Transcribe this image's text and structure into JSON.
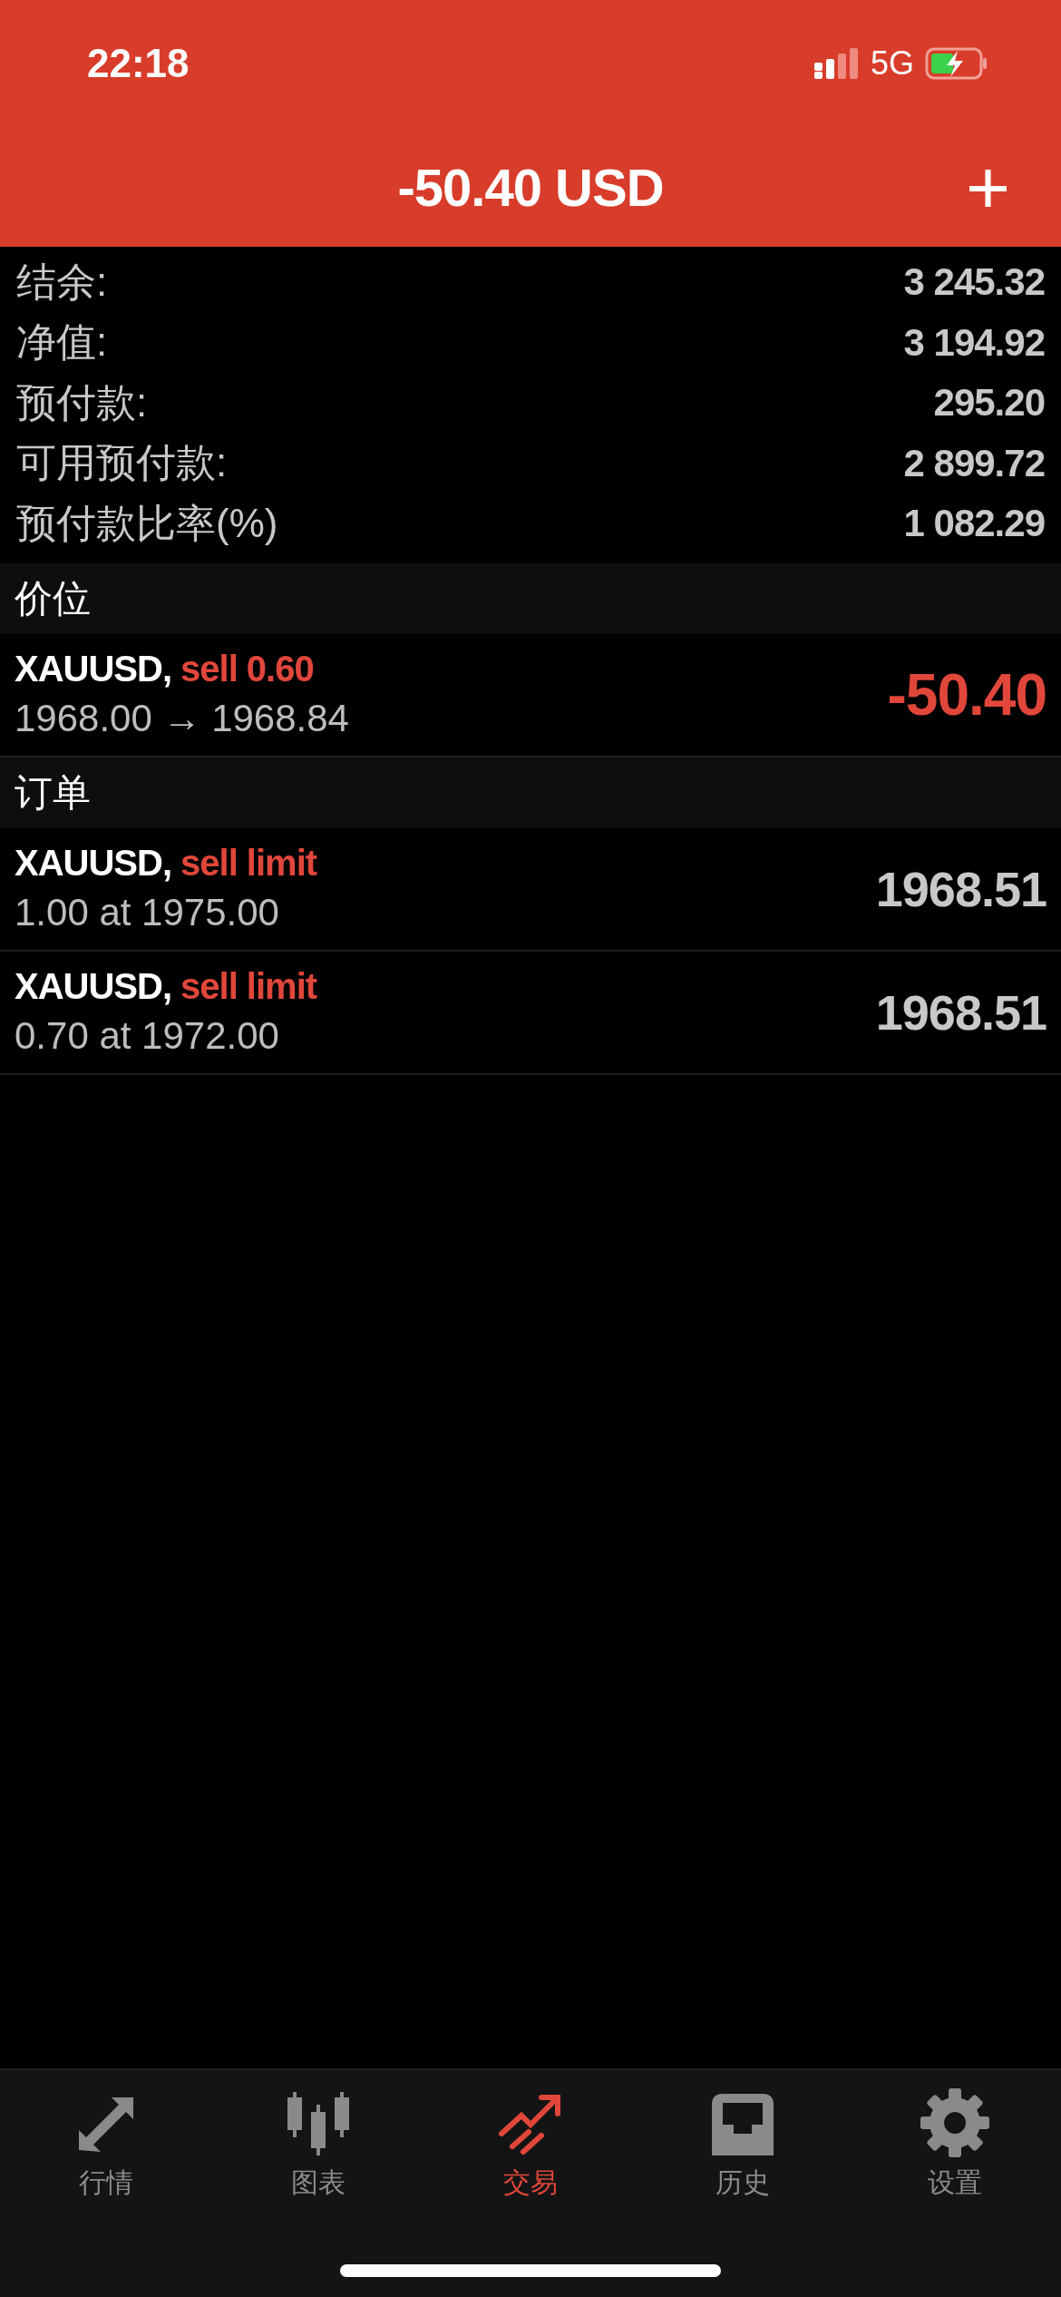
{
  "status_bar": {
    "time": "22:18",
    "network": "5G"
  },
  "header": {
    "title": "-50.40 USD",
    "add_icon": "+"
  },
  "summary": [
    {
      "label": "结余:",
      "value": "3 245.32"
    },
    {
      "label": "净值:",
      "value": "3 194.92"
    },
    {
      "label": "预付款:",
      "value": "295.20"
    },
    {
      "label": "可用预付款:",
      "value": "2 899.72"
    },
    {
      "label": "预付款比率(%)",
      "value": "1 082.29"
    }
  ],
  "positions": {
    "title": "价位",
    "rows": [
      {
        "symbol": "XAUUSD,",
        "action": "sell 0.60",
        "detail": "1968.00 → 1968.84",
        "amount": "-50.40",
        "kind": "profit"
      }
    ]
  },
  "orders": {
    "title": "订单",
    "rows": [
      {
        "symbol": "XAUUSD,",
        "action": "sell limit",
        "detail": "1.00 at 1975.00",
        "amount": "1968.51",
        "kind": "price"
      },
      {
        "symbol": "XAUUSD,",
        "action": "sell limit",
        "detail": "0.70 at 1972.00",
        "amount": "1968.51",
        "kind": "price"
      }
    ]
  },
  "tab_bar": [
    {
      "label": "行情",
      "kind": "quotes",
      "selected": false
    },
    {
      "label": "图表",
      "kind": "chart",
      "selected": false
    },
    {
      "label": "交易",
      "kind": "trade",
      "selected": true
    },
    {
      "label": "历史",
      "kind": "history",
      "selected": false
    },
    {
      "label": "设置",
      "kind": "settings",
      "selected": false
    }
  ]
}
